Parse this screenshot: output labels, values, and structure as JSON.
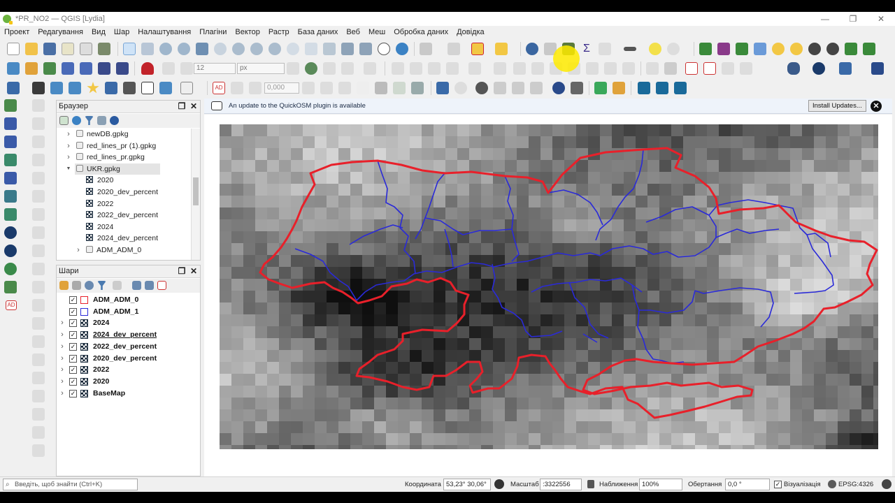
{
  "window": {
    "title": "*PR_NO2 — QGIS [Lydia]",
    "controls": [
      "—",
      "❐",
      "✕"
    ]
  },
  "menu": [
    "Проект",
    "Редагування",
    "Вид",
    "Шар",
    "Налаштування",
    "Плагіни",
    "Вектор",
    "Растр",
    "База даних",
    "Веб",
    "Меш",
    "Обробка даних",
    "Довідка"
  ],
  "toolbar": {
    "font_size_value": "12",
    "font_unit_value": "px",
    "offset_value": "0,000"
  },
  "browser_panel": {
    "title": "Браузер",
    "items": [
      {
        "label": "newDB.gpkg",
        "kind": "gpkg",
        "level": 1,
        "expanded": false
      },
      {
        "label": "red_lines_pr (1).gpkg",
        "kind": "gpkg",
        "level": 1,
        "expanded": false
      },
      {
        "label": "red_lines_pr.gpkg",
        "kind": "gpkg",
        "level": 1,
        "expanded": false
      },
      {
        "label": "UKR.gpkg",
        "kind": "gpkg",
        "level": 1,
        "expanded": true
      },
      {
        "label": "2020",
        "kind": "raster",
        "level": 2
      },
      {
        "label": "2020_dev_percent",
        "kind": "raster",
        "level": 2
      },
      {
        "label": "2022",
        "kind": "raster",
        "level": 2
      },
      {
        "label": "2022_dev_percent",
        "kind": "raster",
        "level": 2
      },
      {
        "label": "2024",
        "kind": "raster",
        "level": 2
      },
      {
        "label": "2024_dev_percent",
        "kind": "raster",
        "level": 2
      },
      {
        "label": "ADM_ADM_0",
        "kind": "vector",
        "level": 2,
        "expanded": false
      }
    ]
  },
  "layers_panel": {
    "title": "Шари",
    "layers": [
      {
        "label": "ADM_ADM_0",
        "symbol": "polygon-red",
        "checked": true,
        "expandable": false,
        "underline": false
      },
      {
        "label": "ADM_ADM_1",
        "symbol": "polygon-blue",
        "checked": true,
        "expandable": false,
        "underline": false
      },
      {
        "label": "2024",
        "symbol": "raster",
        "checked": true,
        "expandable": true,
        "underline": false
      },
      {
        "label": "2024_dev_percent",
        "symbol": "raster",
        "checked": true,
        "expandable": true,
        "underline": true
      },
      {
        "label": "2022_dev_percent",
        "symbol": "raster",
        "checked": true,
        "expandable": true,
        "underline": false
      },
      {
        "label": "2020_dev_percent",
        "symbol": "raster",
        "checked": true,
        "expandable": true,
        "underline": false
      },
      {
        "label": "2022",
        "symbol": "raster",
        "checked": true,
        "expandable": true,
        "underline": false
      },
      {
        "label": "2020",
        "symbol": "raster",
        "checked": true,
        "expandable": true,
        "underline": false
      },
      {
        "label": "BaseMap",
        "symbol": "raster",
        "checked": true,
        "expandable": true,
        "underline": false
      }
    ]
  },
  "message_bar": {
    "text": "An update to the QuickOSM plugin is available",
    "button_label": "Install Updates..."
  },
  "colors": {
    "country_border": "#e8202a",
    "region_border": "#2a2ad8",
    "accent_highlight": "#ffeb00"
  },
  "status_bar": {
    "search_placeholder": "Введіть, щоб знайти (Ctrl+K)",
    "coordinate_label": "Координата",
    "coordinate_value": "53,23° 30,06°",
    "scale_label": "Масштаб",
    "scale_value": ":3322556",
    "magnifier_label": "Наближення",
    "magnifier_value": "100%",
    "rotation_label": "Обертання",
    "rotation_value": "0,0 °",
    "render_label": "Візуалізація",
    "render_checked": true,
    "crs_label": "EPSG:4326"
  }
}
